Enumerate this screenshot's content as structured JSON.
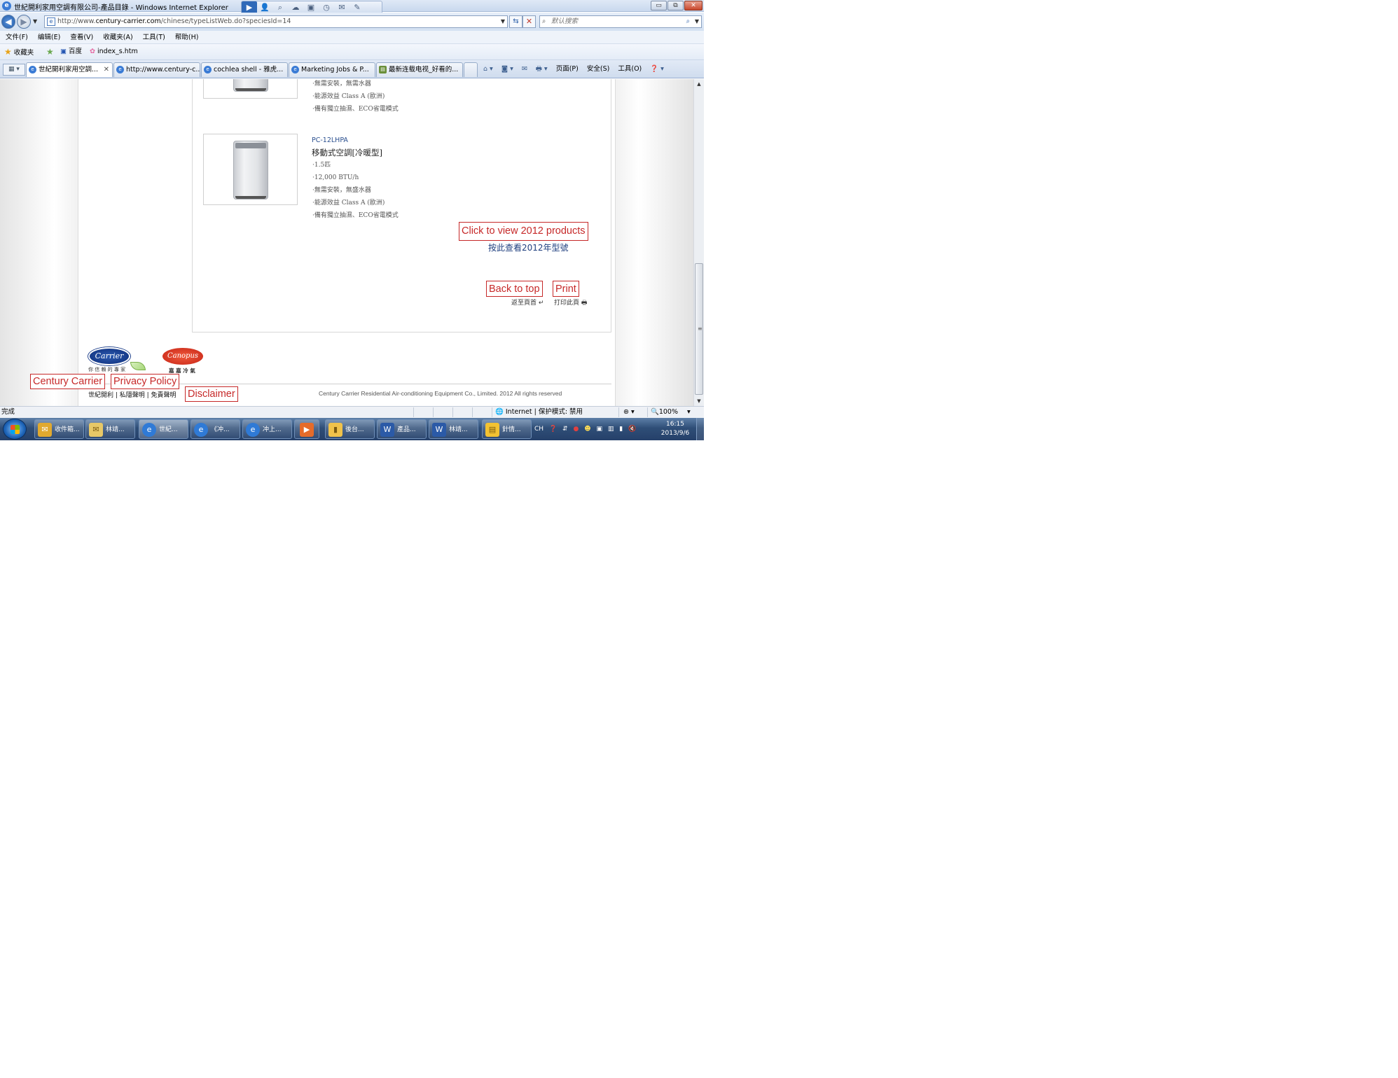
{
  "window": {
    "title": "世紀開利家用空調有限公司-產品目錄 - Windows Internet Explorer",
    "minimize": "▭",
    "restore": "⧉",
    "close": "✕"
  },
  "address": {
    "url_prefix": "http://www.",
    "url_domain": "century-carrier.com",
    "url_path": "/chinese/typeListWeb.do?speciesId=14",
    "search_placeholder": "默认搜索"
  },
  "menu": [
    "文件(F)",
    "编辑(E)",
    "查看(V)",
    "收藏夹(A)",
    "工具(T)",
    "帮助(H)"
  ],
  "favorites": {
    "label": "收藏夹",
    "items": [
      "百度",
      "index_s.htm"
    ]
  },
  "tabs": [
    {
      "label": "世紀開利家用空調..."
    },
    {
      "label": "http://www.century-c..."
    },
    {
      "label": "cochlea shell - 雅虎..."
    },
    {
      "label": "Marketing Jobs & P..."
    },
    {
      "label": "最新连载电视_好看的..."
    }
  ],
  "commandbar": {
    "page": "页面(P)",
    "safety": "安全(S)",
    "tools": "工具(O)"
  },
  "page": {
    "prev_product_specs": [
      "·無需安裝，無需水器",
      "·能源效益 Class A (歐洲)",
      "·備有獨立抽濕、ECO省電模式"
    ],
    "product": {
      "code": "PC-12LHPA",
      "name": "移動式空調[冷暖型]",
      "specs": [
        "·1.5匹",
        "·12,000 BTU/h",
        "·無需安裝，無盛水器",
        "·能源效益 Class A (歐洲)",
        "·備有獨立抽濕、ECO省電模式"
      ]
    },
    "annotation_2012": "Click to view 2012 products",
    "view_2012": "按此查看2012年型號",
    "annotation_back_top": "Back to top",
    "annotation_print": "Print",
    "back_top": "返至頁首 ↵",
    "print": "打印此頁 🖶",
    "carrier_logo": "Carrier",
    "carrier_tagline": "你 信 賴 的 專 家",
    "canopus_logo": "Canopus",
    "canopus_tagline": "嘉 嘉 冷 氣",
    "annotation_century": "Century Carrier",
    "annotation_privacy": "Privacy Policy",
    "annotation_disclaimer": "Disclaimer",
    "footer_links": "世紀開利 | 私隱聲明 | 免責聲明",
    "copyright": "Century Carrier Residential Air-conditioning Equipment Co., Limited. 2012 All rights reserved"
  },
  "status": {
    "text": "完成",
    "zone": "Internet | 保护模式: 禁用",
    "zoom": "100%"
  },
  "taskbar": {
    "items": [
      {
        "label": "收件箱..."
      },
      {
        "label": "林靖..."
      },
      {
        "label": "世紀..."
      },
      {
        "label": "《冲..."
      },
      {
        "label": "冲上..."
      },
      {
        "label": ""
      },
      {
        "label": "後台..."
      },
      {
        "label": "產品..."
      },
      {
        "label": "林靖..."
      },
      {
        "label": "針情..."
      }
    ],
    "lang": "CH",
    "time": "16:15",
    "date": "2013/9/6"
  }
}
